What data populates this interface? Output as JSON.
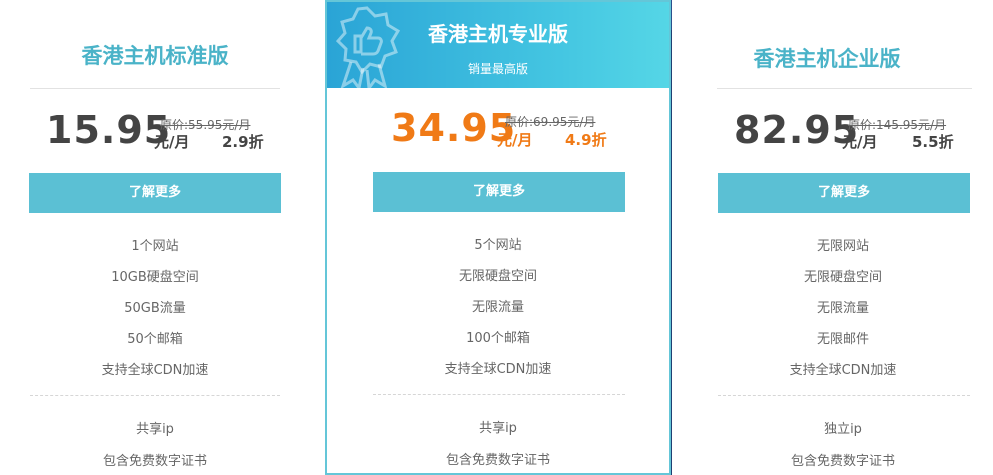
{
  "plans": [
    {
      "title": "香港主机标准版",
      "price": "15.95",
      "original": "原价:55.95元/月",
      "unit": "元/月",
      "discount": "2.9折",
      "button": "了解更多",
      "features": [
        "1个网站",
        "10GB硬盘空间",
        "50GB流量",
        "50个邮箱",
        "支持全球CDN加速"
      ],
      "extras": [
        "共享ip",
        "包含免费数字证书"
      ]
    },
    {
      "title": "香港主机专业版",
      "subtitle": "销量最高版",
      "price": "34.95",
      "original": "原价:69.95元/月",
      "unit": "元/月",
      "discount": "4.9折",
      "button": "了解更多",
      "features": [
        "5个网站",
        "无限硬盘空间",
        "无限流量",
        "100个邮箱",
        "支持全球CDN加速"
      ],
      "extras": [
        "共享ip",
        "包含免费数字证书"
      ]
    },
    {
      "title": "香港主机企业版",
      "price": "82.95",
      "original": "原价:145.95元/月",
      "unit": "元/月",
      "discount": "5.5折",
      "button": "了解更多",
      "features": [
        "无限网站",
        "无限硬盘空间",
        "无限流量",
        "无限邮件",
        "支持全球CDN加速"
      ],
      "extras": [
        "独立ip",
        "包含免费数字证书"
      ]
    }
  ],
  "colors": {
    "accent": "#4ab3c8",
    "button": "#5bc0d4",
    "highlight_price": "#f07a16"
  },
  "icons": {
    "featured_badge": "thumbs-up-badge-icon"
  }
}
